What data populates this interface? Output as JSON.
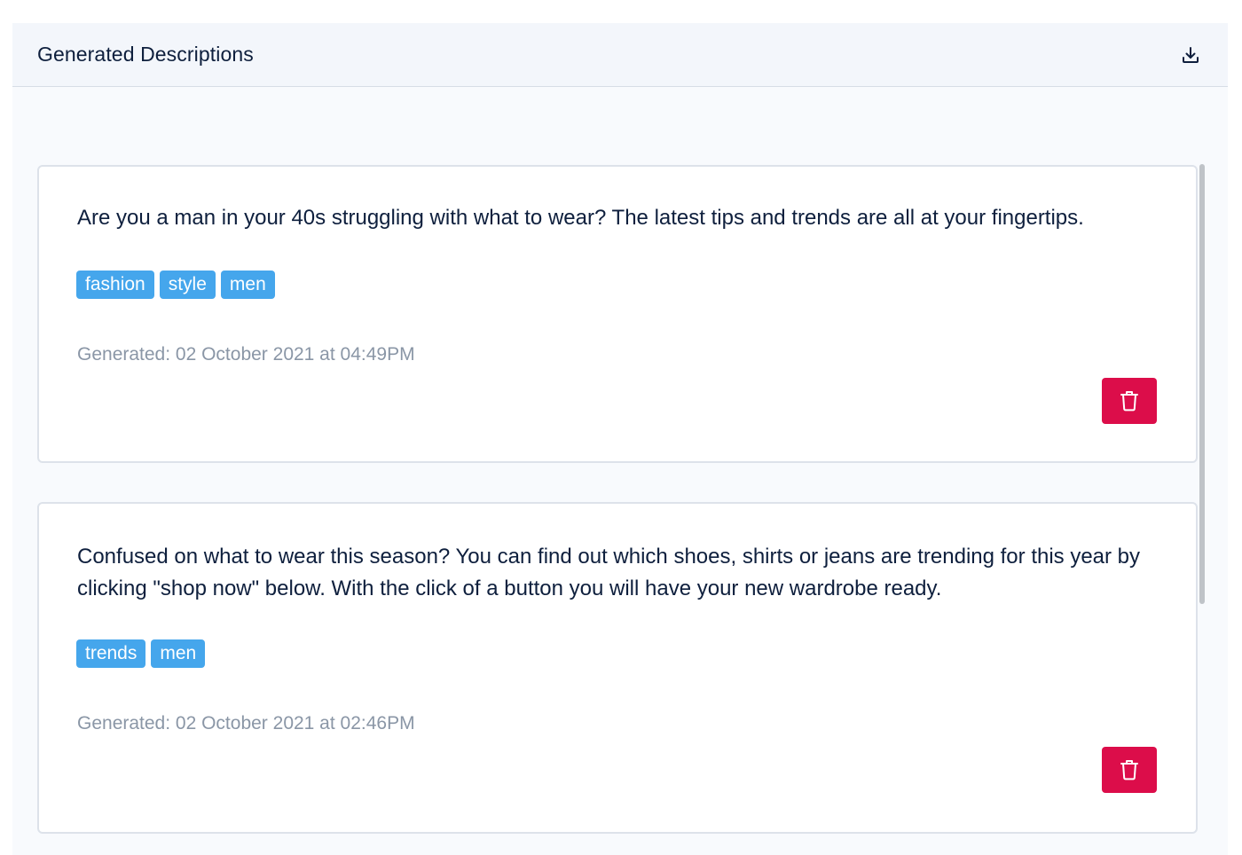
{
  "panel": {
    "title": "Generated Descriptions",
    "download_icon": "download-icon"
  },
  "descriptions": [
    {
      "text": "Are you a man in your 40s struggling with what to wear? The latest tips and trends are all at your fingertips.",
      "tags": [
        "fashion",
        "style",
        "men"
      ],
      "generated": "Generated: 02 October 2021 at 04:49PM",
      "delete_icon": "trash-icon"
    },
    {
      "text": "Confused on what to wear this season? You can find out which shoes, shirts or jeans are trending for this year by clicking \"shop now\" below. With the click of a button you will have your new wardrobe ready.",
      "tags": [
        "trends",
        "men"
      ],
      "generated": "Generated: 02 October 2021 at 02:46PM",
      "delete_icon": "trash-icon"
    }
  ],
  "colors": {
    "tag": "#45a6ec",
    "delete": "#dc0d4a",
    "text": "#0e1f3d",
    "muted": "#8a96a6"
  }
}
